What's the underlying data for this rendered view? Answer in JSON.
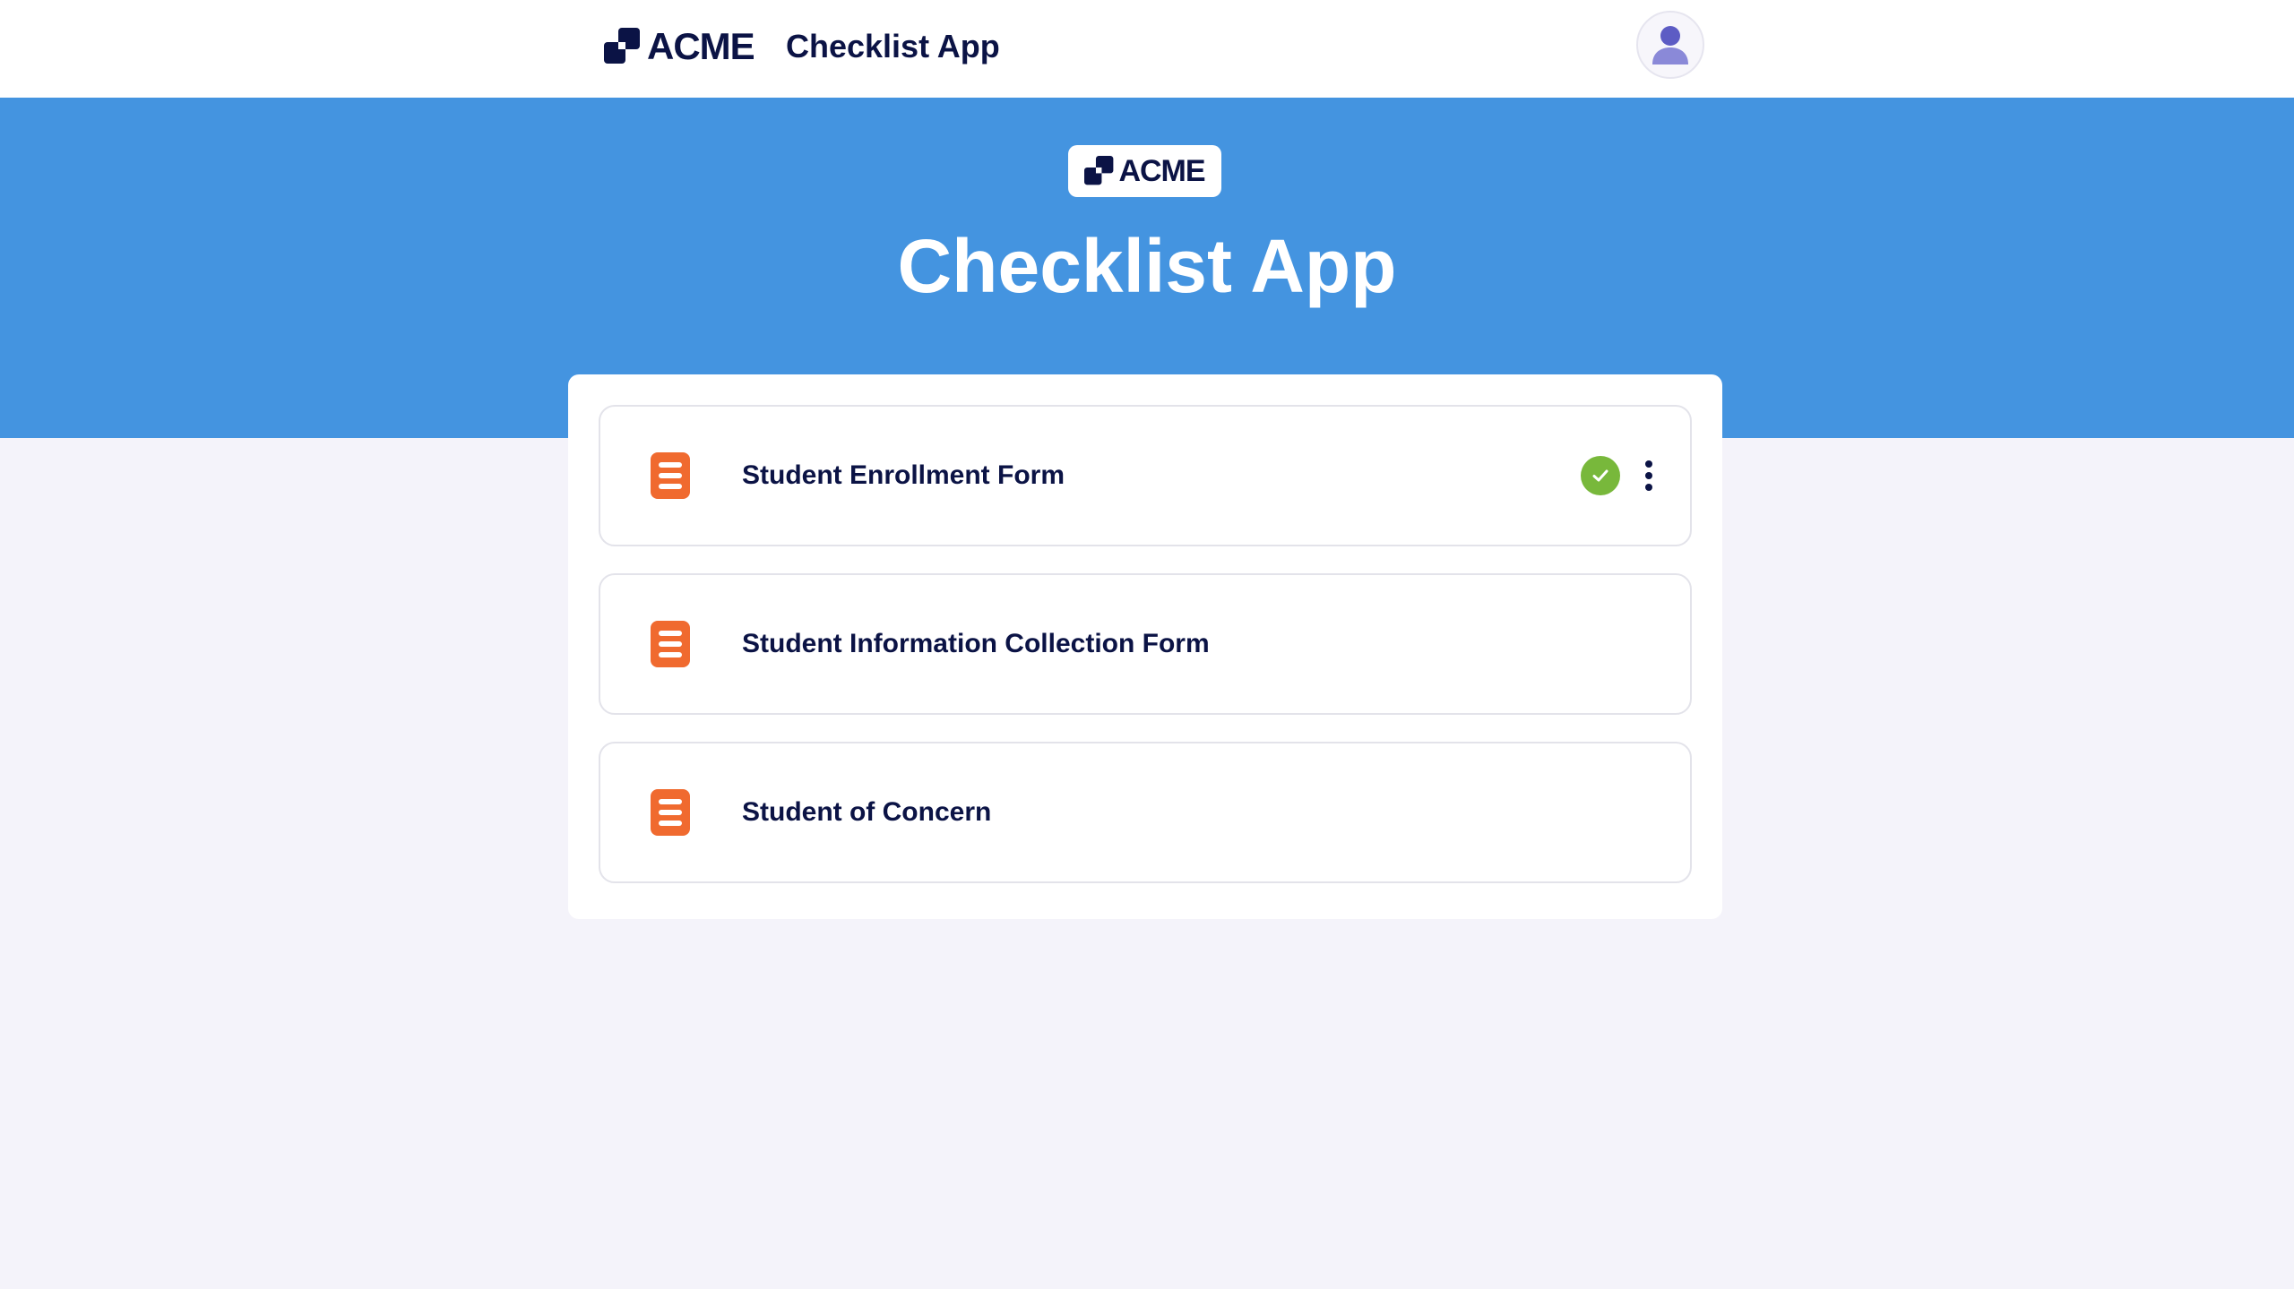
{
  "header": {
    "brand": "ACME",
    "title": "Checklist App",
    "avatar_icon": "user-avatar-icon"
  },
  "hero": {
    "brand": "ACME",
    "title": "Checklist App",
    "color": "#4494e0"
  },
  "forms": [
    {
      "label": "Student Enrollment Form",
      "icon": "form-document-icon",
      "completed": true
    },
    {
      "label": "Student Information Collection Form",
      "icon": "form-document-icon",
      "completed": false
    },
    {
      "label": "Student of Concern",
      "icon": "form-document-icon",
      "completed": false
    }
  ],
  "colors": {
    "navy": "#0b1345",
    "form_icon": "#f06a2f",
    "complete": "#78b83b",
    "background": "#f4f3fa"
  }
}
